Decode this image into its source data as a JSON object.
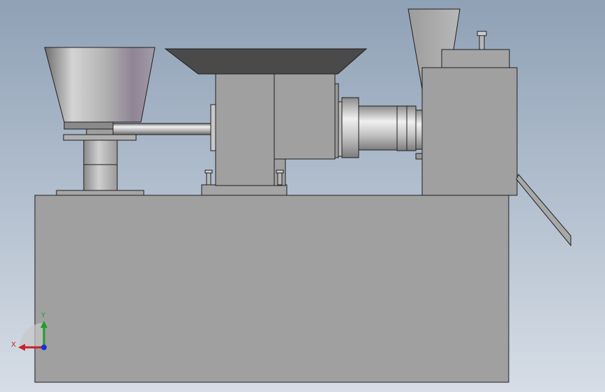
{
  "viewport": {
    "background_top": "#8fa1b6",
    "background_bottom": "#d6dde6"
  },
  "model": {
    "body_color": "#a0a0a0",
    "edge_color": "#1e1e1e",
    "chute_color": "#4a4a4a"
  },
  "triad": {
    "x_label": "X",
    "y_label": "Y",
    "x_color": "#c8202a",
    "y_color": "#1f9d2a",
    "z_color": "#1c2fd8"
  }
}
